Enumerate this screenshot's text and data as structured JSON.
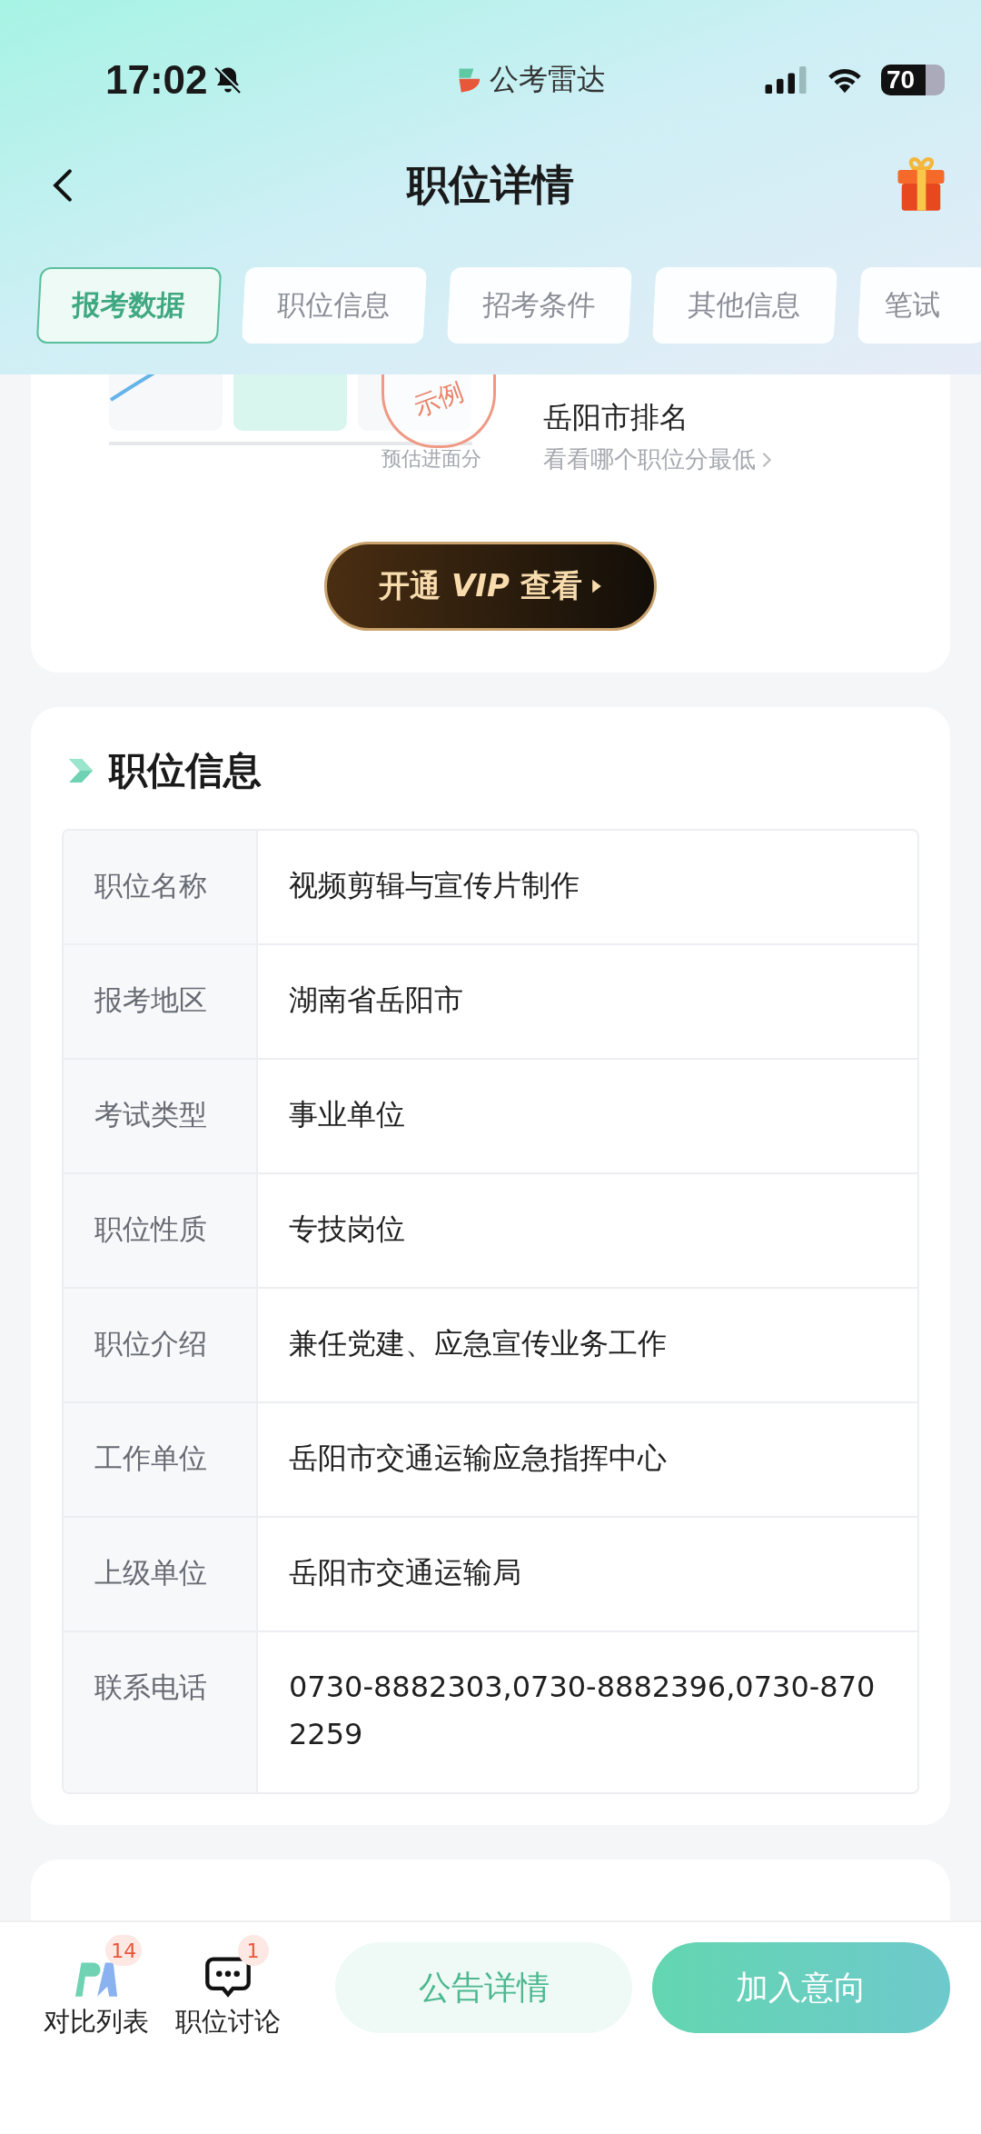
{
  "status_bar": {
    "time": "17:02",
    "battery": "70"
  },
  "app_logo": {
    "name": "公考雷达"
  },
  "nav": {
    "title": "职位详情"
  },
  "tabs": [
    {
      "label": "报考数据",
      "selected": true
    },
    {
      "label": "职位信息",
      "selected": false
    },
    {
      "label": "招考条件",
      "selected": false
    },
    {
      "label": "其他信息",
      "selected": false
    },
    {
      "label": "笔试",
      "selected": false
    }
  ],
  "rank_card": {
    "stamp": "示例",
    "axis_label": "预估进面分",
    "title": "岳阳市排名",
    "link": "看看哪个职位分最低",
    "vip_button": "开通 *VIP* 查看"
  },
  "position_info": {
    "title": "职位信息",
    "rows": [
      {
        "label": "职位名称",
        "value": "视频剪辑与宣传片制作"
      },
      {
        "label": "报考地区",
        "value": "湖南省岳阳市"
      },
      {
        "label": "考试类型",
        "value": "事业单位"
      },
      {
        "label": "职位性质",
        "value": "专技岗位"
      },
      {
        "label": "职位介绍",
        "value": "兼任党建、应急宣传业务工作"
      },
      {
        "label": "工作单位",
        "value": "岳阳市交通运输应急指挥中心"
      },
      {
        "label": "上级单位",
        "value": "岳阳市交通运输局"
      },
      {
        "label": "联系电话",
        "value": "0730-8882303,0730-8882396,0730-8702259"
      }
    ]
  },
  "bottom_bar": {
    "items": [
      {
        "kind": "compare",
        "label": "对比列表",
        "badge": "14"
      },
      {
        "kind": "chat",
        "label": "职位讨论",
        "badge": "1"
      }
    ],
    "buttons": [
      {
        "kind": "secondary",
        "label": "公告详情"
      },
      {
        "kind": "primary",
        "label": "加入意向"
      }
    ]
  }
}
